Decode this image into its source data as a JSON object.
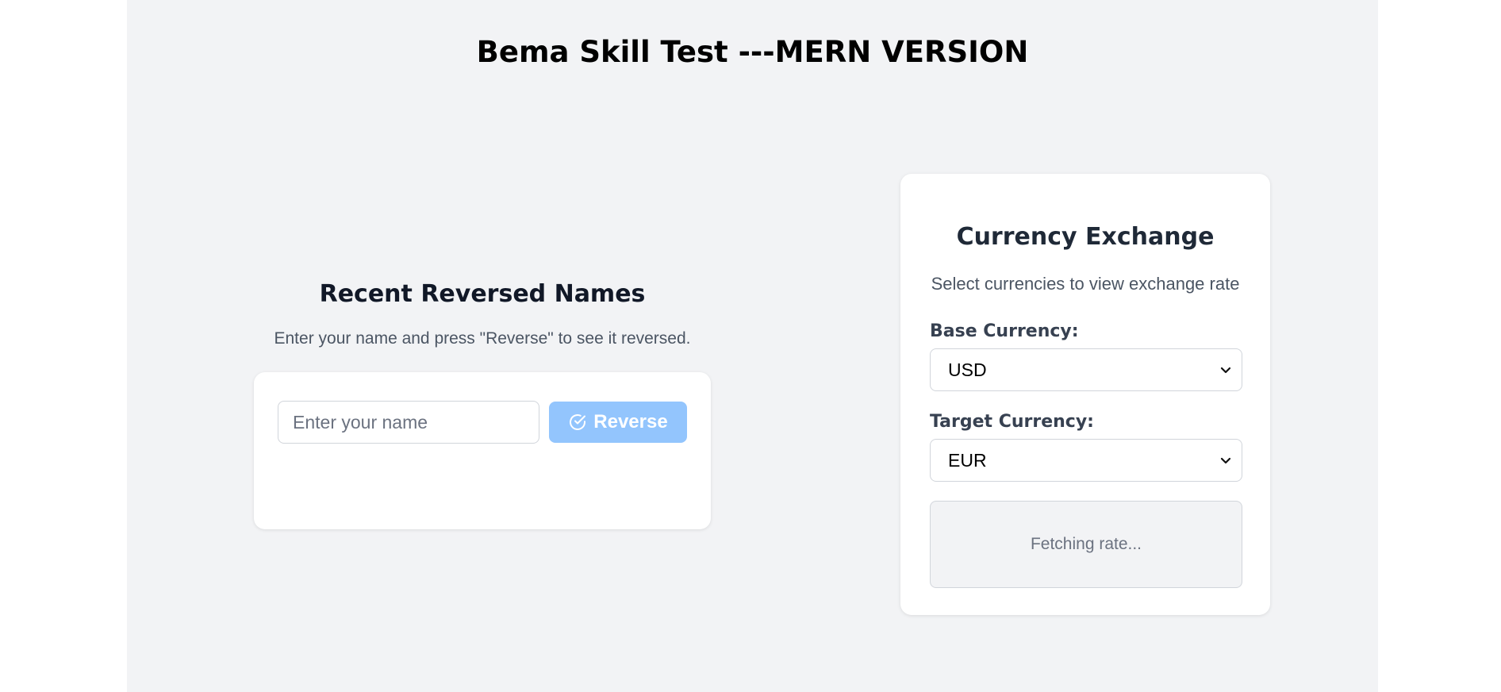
{
  "page": {
    "title": "Bema Skill Test ---MERN VERSION"
  },
  "reverse": {
    "heading": "Recent Reversed Names",
    "description": "Enter your name and press \"Reverse\" to see it reversed.",
    "input_placeholder": "Enter your name",
    "input_value": "",
    "button_label": "Reverse",
    "button_icon": "check-circle-icon",
    "button_color": "#93c5fd"
  },
  "currency": {
    "title": "Currency Exchange",
    "description": "Select currencies to view exchange rate",
    "base_label": "Base Currency:",
    "base_value": "USD",
    "target_label": "Target Currency:",
    "target_value": "EUR",
    "rate_status": "Fetching rate..."
  },
  "colors": {
    "app_background": "#f2f3f5",
    "card_background": "#ffffff"
  }
}
